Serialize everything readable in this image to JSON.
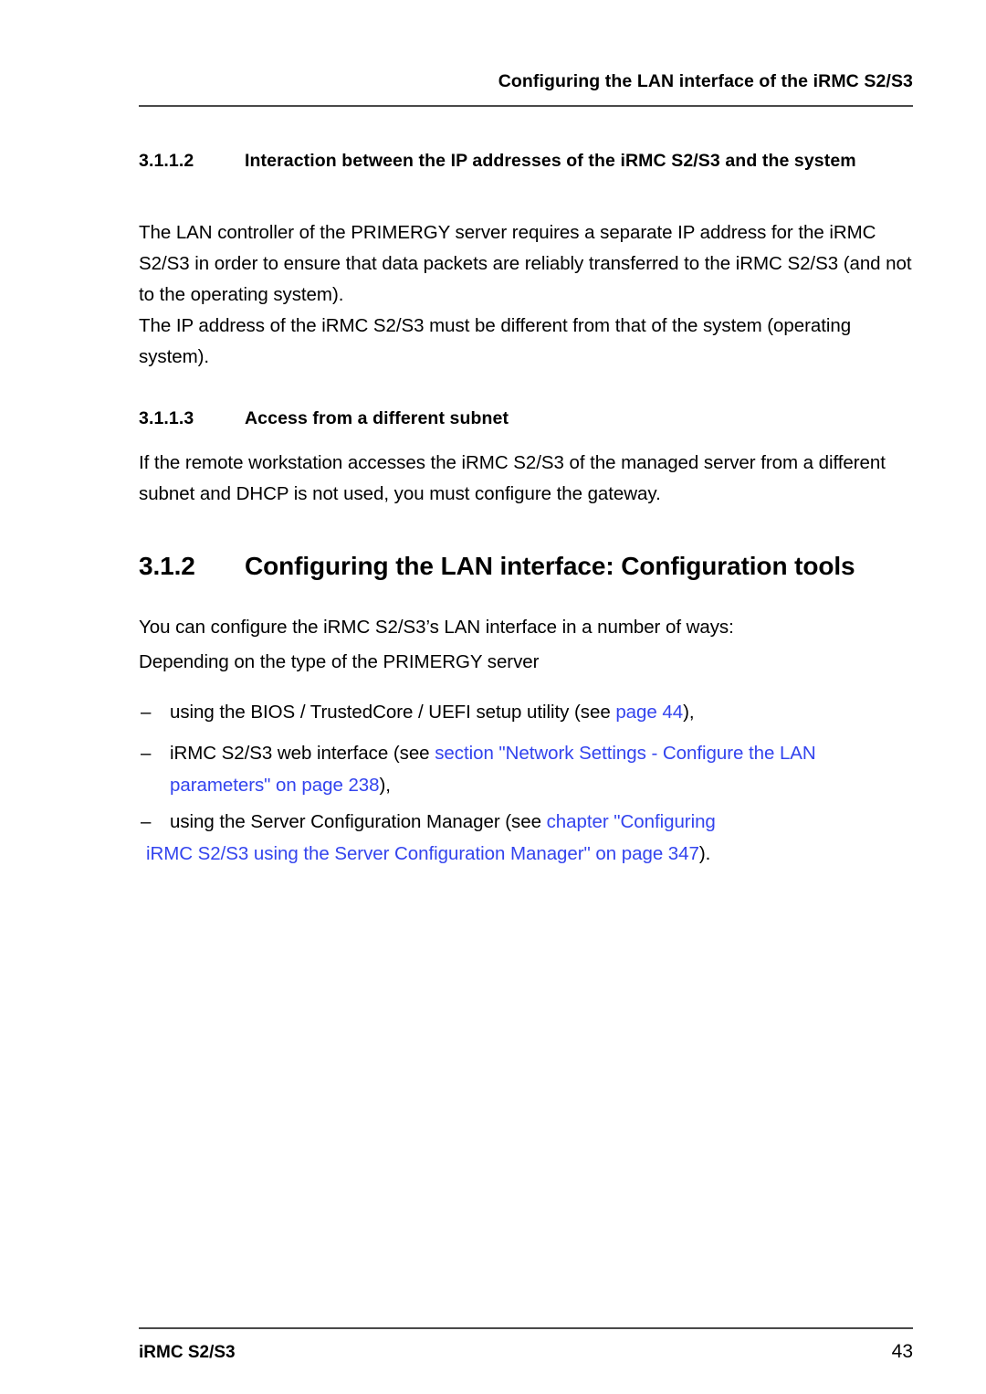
{
  "document": {
    "running_header": "Configuring the LAN interface of the iRMC S2/S3",
    "footer_left": "iRMC S2/S3",
    "page_number": "43",
    "link_color": "#3344ee",
    "rule_color": "#4a4a4a"
  },
  "sections": {
    "s3112": {
      "number": "3.1.1.2",
      "title": "Interaction between the IP addresses of the iRMC S2/S3 and the system",
      "paragraphs": [
        "The LAN controller of the PRIMERGY server requires a separate IP address for the iRMC S2/S3 in order to ensure that data packets are reliably transferred to the iRMC S2/S3 (and not to the operating system).",
        "The IP address of the iRMC S2/S3 must be different from that of the system (operating system)."
      ]
    },
    "s3113": {
      "number": "3.1.1.3",
      "title": "Access from a different subnet",
      "paragraphs": [
        "If the remote workstation accesses the iRMC S2/S3 of the managed server from a different subnet and DHCP is not used, you must configure the gateway."
      ]
    },
    "s312": {
      "number": "3.1.2",
      "title": "Configuring the LAN interface: Configuration tools",
      "paragraphs": [
        "You can configure the iRMC S2/S3’s LAN interface in a number of ways:",
        "Depending on the type of the PRIMERGY server"
      ],
      "list": {
        "marker": "–",
        "items": [
          {
            "lead": "using the BIOS / TrustedCore / UEFI setup utility (see ",
            "link": "page 44",
            "tail": "),"
          },
          {
            "lead": "iRMC S2/S3 web interface (see ",
            "link": "section \"Network Settings - Configure the LAN parameters\" on page 238",
            "tail": "),"
          },
          {
            "lead": "using the Server Configuration Manager (see ",
            "link_part1": "chapter \"Configuring",
            "link_part2": "iRMC S2/S3 using the Server Configuration Manager\" on page 347",
            "tail": ")."
          }
        ]
      }
    }
  }
}
